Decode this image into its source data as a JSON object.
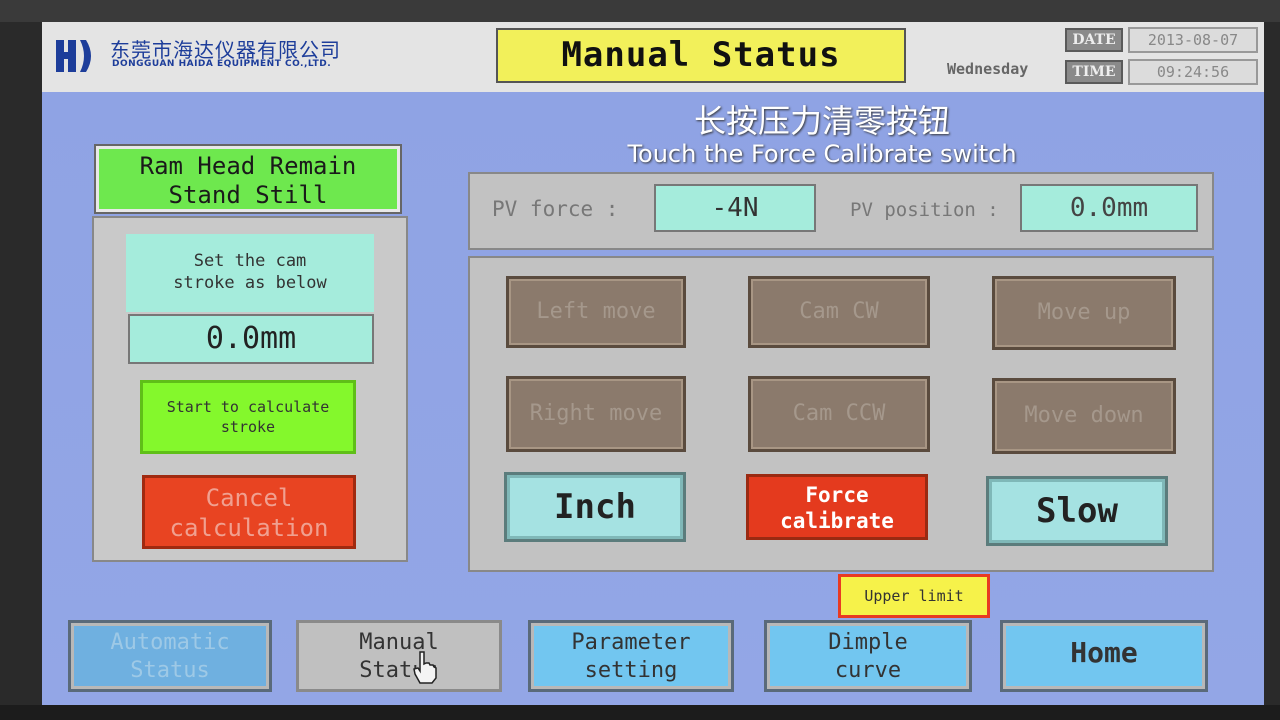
{
  "header": {
    "company_cn": "东莞市海达仪器有限公司",
    "company_en": "DONGGUAN HAIDA EQUIPMENT CO.,LTD.",
    "title": "Manual Status",
    "weekday": "Wednesday",
    "date_label": "DATE",
    "date_value": "2013-08-07",
    "time_label": "TIME",
    "time_value": "09:24:56"
  },
  "overlay": {
    "cn": "长按压力清零按钮",
    "en": "Touch the Force Calibrate switch"
  },
  "left": {
    "ram_status_line1": "Ram Head Remain",
    "ram_status_line2": "Stand Still",
    "cam_label_line1": "Set the cam",
    "cam_label_line2": "stroke as below",
    "cam_value": "0.0mm",
    "start_line1": "Start to calculate",
    "start_line2": "stroke",
    "cancel_line1": "Cancel",
    "cancel_line2": "calculation"
  },
  "pv": {
    "force_label": "PV force :",
    "force_value": "-4N",
    "position_label": "PV position :",
    "position_value": "0.0mm"
  },
  "controls": {
    "left_move": "Left move",
    "cam_cw": "Cam CW",
    "move_up": "Move up",
    "right_move": "Right move",
    "cam_ccw": "Cam CCW",
    "move_down": "Move down",
    "inch": "Inch",
    "force_cal_line1": "Force",
    "force_cal_line2": "calibrate",
    "slow": "Slow"
  },
  "upper_limit": "Upper limit",
  "nav": {
    "auto_line1": "Automatic",
    "auto_line2": "Status",
    "manual_line1": "Manual",
    "manual_line2": "Status",
    "param_line1": "Parameter",
    "param_line2": "setting",
    "dimple_line1": "Dimple",
    "dimple_line2": "curve",
    "home": "Home"
  },
  "colors": {
    "background": "#8ea2e2",
    "title_yellow": "#f2f05a",
    "status_green": "#6ee84e",
    "teal_value": "#a5ecdc",
    "start_green": "#84f82c",
    "cancel_red": "#e84422",
    "force_red": "#e43a1e",
    "nav_blue": "#72c6f0"
  },
  "icons": {
    "logo": "haida-logo-icon",
    "cursor": "hand-pointer-icon"
  }
}
